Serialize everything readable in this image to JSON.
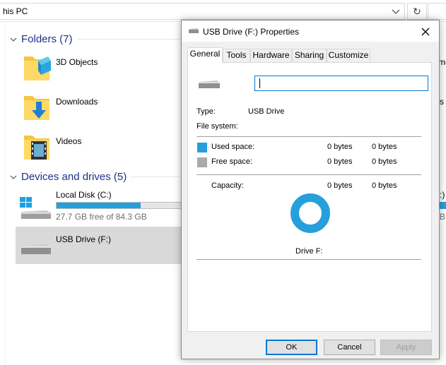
{
  "explorer": {
    "address": "his PC",
    "folders_header": "Folders (7)",
    "folders": [
      {
        "label": "3D Objects",
        "icon": "3d-objects-folder-icon"
      },
      {
        "label": "Downloads",
        "icon": "downloads-folder-icon"
      },
      {
        "label": "Videos",
        "icon": "videos-folder-icon"
      }
    ],
    "devices_header": "Devices and drives (5)",
    "drives": [
      {
        "label": "Local Disk (C:)",
        "free": "27.7 GB free of 84.3 GB",
        "used_fraction": 0.67
      },
      {
        "label": "USB Drive (F:)"
      }
    ],
    "right_fragments": [
      "me",
      "s",
      ":)"
    ]
  },
  "dialog": {
    "title": "USB Drive (F:) Properties",
    "tabs": [
      "General",
      "Tools",
      "Hardware",
      "Sharing",
      "Customize"
    ],
    "name_value": "",
    "type_label": "Type:",
    "type_value": "USB Drive",
    "fs_label": "File system:",
    "fs_value": "",
    "used_label": "Used space:",
    "used_bytes": "0 bytes",
    "used_bytes2": "0 bytes",
    "free_label": "Free space:",
    "free_bytes": "0 bytes",
    "free_bytes2": "0 bytes",
    "capacity_label": "Capacity:",
    "capacity_bytes": "0 bytes",
    "capacity_bytes2": "0 bytes",
    "drive_label": "Drive F:",
    "buttons": {
      "ok": "OK",
      "cancel": "Cancel",
      "apply": "Apply"
    },
    "colors": {
      "used": "#26a0da",
      "free": "#aaaaaa"
    }
  }
}
